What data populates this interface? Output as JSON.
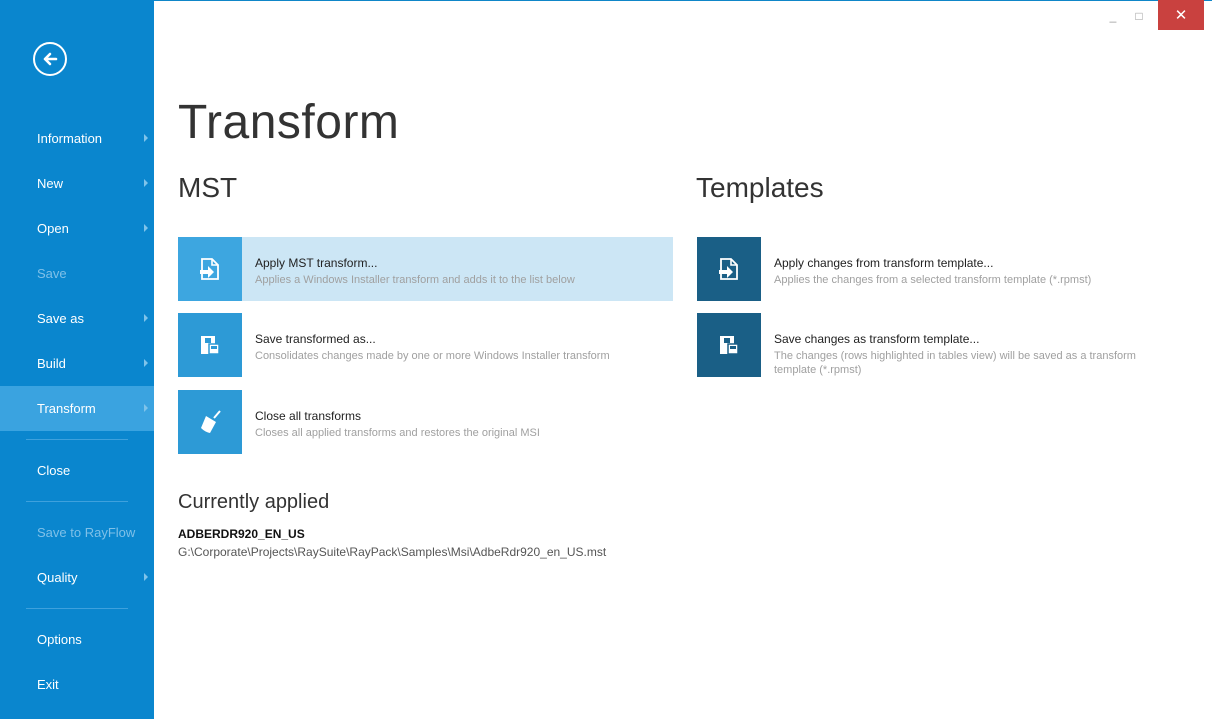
{
  "window": {
    "minimize": "_",
    "maximize": "□",
    "close": "✕"
  },
  "sidebar": {
    "items": [
      {
        "label": "Information",
        "has_arrow": true,
        "state": "normal"
      },
      {
        "label": "New",
        "has_arrow": true,
        "state": "normal"
      },
      {
        "label": "Open",
        "has_arrow": true,
        "state": "normal"
      },
      {
        "label": "Save",
        "has_arrow": false,
        "state": "disabled"
      },
      {
        "label": "Save as",
        "has_arrow": true,
        "state": "normal"
      },
      {
        "label": "Build",
        "has_arrow": true,
        "state": "normal"
      },
      {
        "label": "Transform",
        "has_arrow": true,
        "state": "active"
      },
      {
        "label": "Close",
        "has_arrow": false,
        "state": "normal"
      },
      {
        "label": "Save to RayFlow",
        "has_arrow": false,
        "state": "disabled"
      },
      {
        "label": "Quality",
        "has_arrow": true,
        "state": "normal"
      },
      {
        "label": "Options",
        "has_arrow": false,
        "state": "normal"
      },
      {
        "label": "Exit",
        "has_arrow": false,
        "state": "normal"
      }
    ]
  },
  "main": {
    "title": "Transform",
    "mst": {
      "title": "MST",
      "actions": [
        {
          "label": "Apply MST transform...",
          "desc": "Applies a Windows Installer transform and adds it to the list below",
          "icon": "document-apply-icon"
        },
        {
          "label": "Save transformed as...",
          "desc": "Consolidates changes made by one or more Windows Installer transform",
          "icon": "save-icon"
        },
        {
          "label": "Close all transforms",
          "desc": "Closes all applied transforms and restores the original MSI",
          "icon": "broom-icon"
        }
      ]
    },
    "templates": {
      "title": "Templates",
      "actions": [
        {
          "label": "Apply changes from transform template...",
          "desc": "Applies the changes from a selected transform template (*.rpmst)",
          "icon": "document-apply-icon"
        },
        {
          "label": "Save changes as transform template...",
          "desc": "The changes (rows highlighted in tables view) will be saved as a transform template (*.rpmst)",
          "icon": "save-icon"
        }
      ]
    },
    "currently_applied": {
      "title": "Currently applied",
      "name": "ADBERDR920_EN_US",
      "path": "G:\\Corporate\\Projects\\RaySuite\\RayPack\\Samples\\Msi\\AdbeRdr920_en_US.mst"
    }
  },
  "colors": {
    "sidebar": "#0a86ce",
    "sidebar_active": "#3aa3e0",
    "tile": "#2d9ad6",
    "tile_dark": "#1a5f86",
    "highlight": "#cce6f5",
    "close_button": "#c9413f"
  }
}
